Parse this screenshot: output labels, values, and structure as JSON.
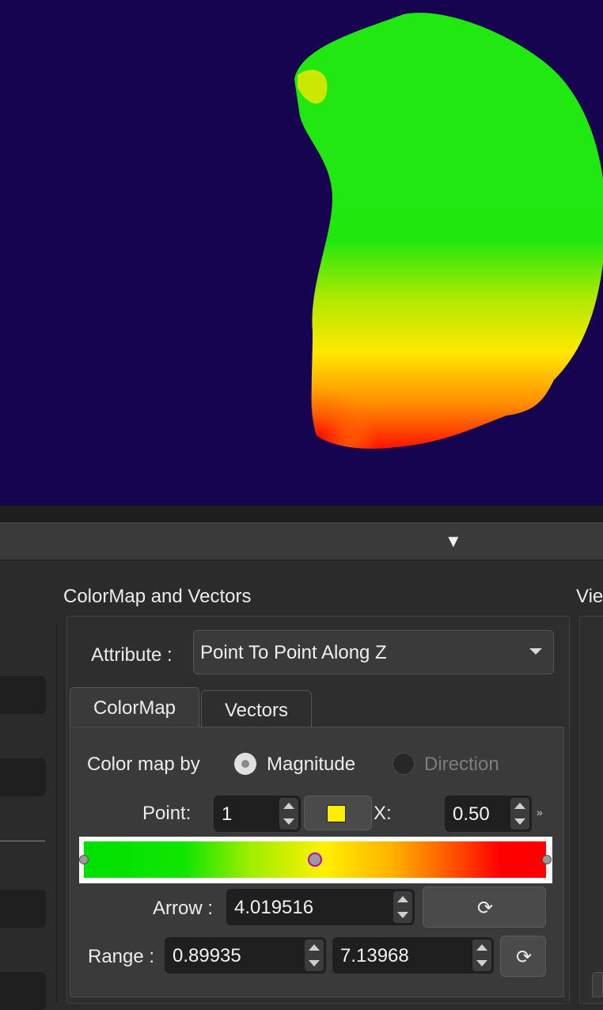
{
  "panel": {
    "section_title": "ColorMap and Vectors",
    "right_section_title": "Vie",
    "attribute_label": "Attribute :",
    "attribute_value": "Point To Point Along Z",
    "tabs": [
      {
        "label": "ColorMap",
        "active": true
      },
      {
        "label": "Vectors",
        "active": false
      }
    ],
    "colormap": {
      "color_map_by_label": "Color map by",
      "options": [
        {
          "label": "Magnitude",
          "selected": true,
          "enabled": true
        },
        {
          "label": "Direction",
          "selected": false,
          "enabled": false
        }
      ],
      "point_label": "Point:",
      "point_value": "1",
      "point_color": "#ffee00",
      "x_label": "X:",
      "x_value": "0.50",
      "more_glyph": "»",
      "gradient_stops": [
        "#00e000",
        "#9fee00",
        "#fff000",
        "#ffb000",
        "#ff5000",
        "#ff0000"
      ],
      "arrow_label": "Arrow :",
      "arrow_value": "4.019516",
      "range_label": "Range :",
      "range_min": "0.89935",
      "range_max": "7.13968",
      "reload_glyph": "⟳"
    }
  },
  "toolbar": {
    "collapse_glyph": "▼"
  },
  "viewport": {
    "background": "#170451"
  }
}
